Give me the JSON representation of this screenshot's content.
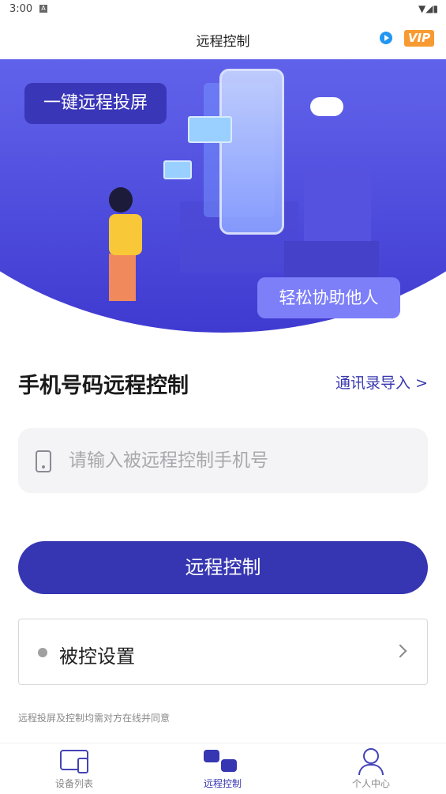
{
  "status_bar": {
    "time": "3:00"
  },
  "header": {
    "title": "远程控制",
    "vip": "VIP",
    "colors": {
      "vip": "#f79a32",
      "play": "#2196f3"
    }
  },
  "banner": {
    "tag_left": "一键远程投屏",
    "tag_right": "轻松协助他人"
  },
  "section": {
    "title": "手机号码远程控制",
    "import_link": "通讯录导入 >"
  },
  "phone_input": {
    "placeholder": "请输入被远程控制手机号",
    "value": ""
  },
  "primary_button": {
    "label": "远程控制",
    "color": "#3636b2"
  },
  "controlled_settings": {
    "label": "被控设置"
  },
  "note": "远程投屏及控制均需对方在线并同意",
  "tabs": [
    {
      "label": "设备列表",
      "icon": "devices-icon"
    },
    {
      "label": "远程控制",
      "icon": "remote-control-icon",
      "active": true
    },
    {
      "label": "个人中心",
      "icon": "user-icon"
    }
  ]
}
